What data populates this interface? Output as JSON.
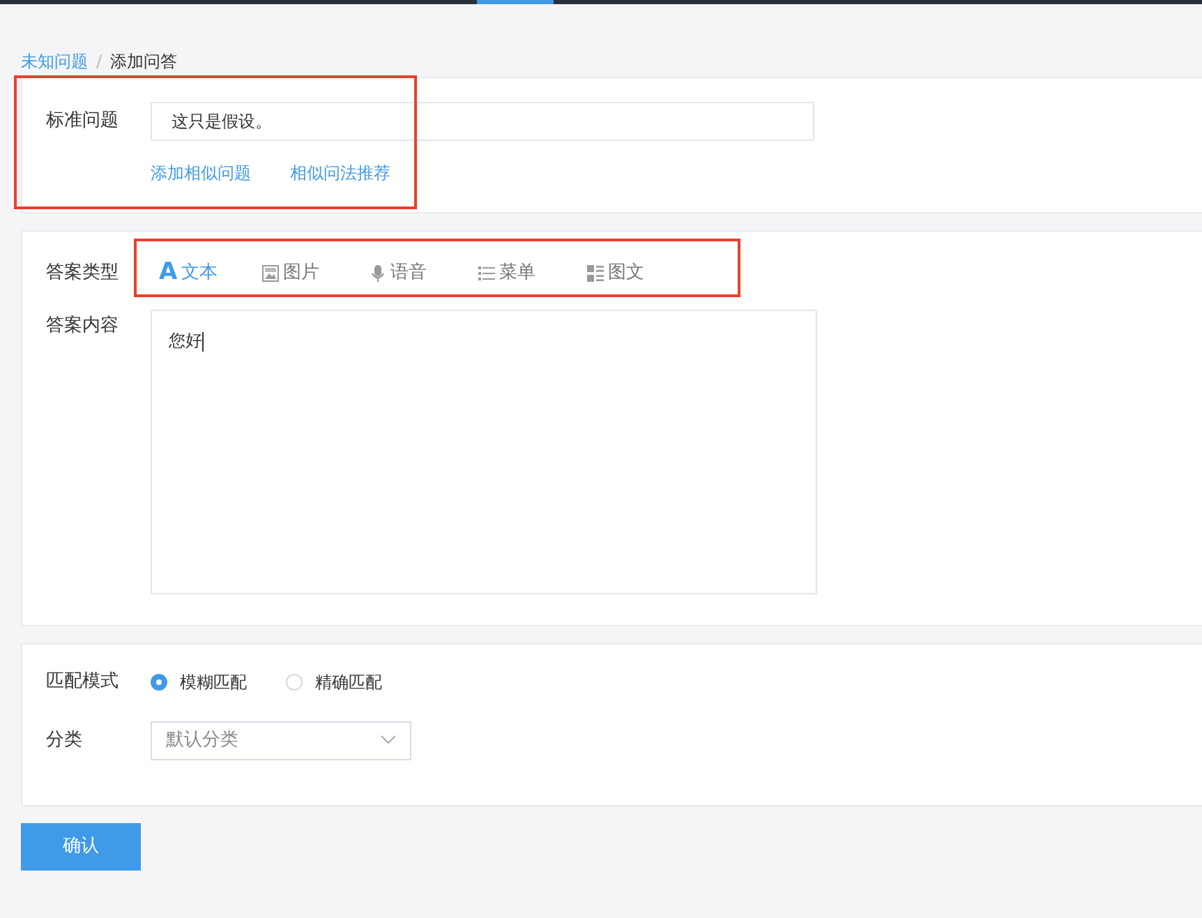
{
  "top_bar": {
    "kind": "bar"
  },
  "breadcrumb_separator": "/",
  "breadcrumb": [
    {
      "label": "未知问题",
      "selected": false
    },
    {
      "label": "添加问答",
      "selected": true
    }
  ],
  "question": {
    "label": "标准问题",
    "value": "这只是假设。",
    "highlighted": true,
    "links": [
      "添加相似问题",
      "相似问法推荐"
    ]
  },
  "answer_type": {
    "label": "答案类型",
    "highlighted": true,
    "tabs": [
      {
        "kind": "text",
        "glyph": "A",
        "label": "文本",
        "selected": true
      },
      {
        "kind": "image",
        "label": "图片",
        "selected": false
      },
      {
        "kind": "voice",
        "label": "语音",
        "selected": false
      },
      {
        "kind": "menu",
        "label": "菜单",
        "selected": false
      },
      {
        "kind": "imagetext",
        "label": "图文",
        "selected": false
      }
    ]
  },
  "answer_content": {
    "label": "答案内容",
    "value": "您好"
  },
  "match_mode": {
    "label": "匹配模式",
    "options": [
      {
        "label": "模糊匹配",
        "selected": true
      },
      {
        "label": "精确匹配",
        "selected": false
      }
    ]
  },
  "category": {
    "label": "分类",
    "value": "默认分类"
  },
  "confirm_button": "确认"
}
